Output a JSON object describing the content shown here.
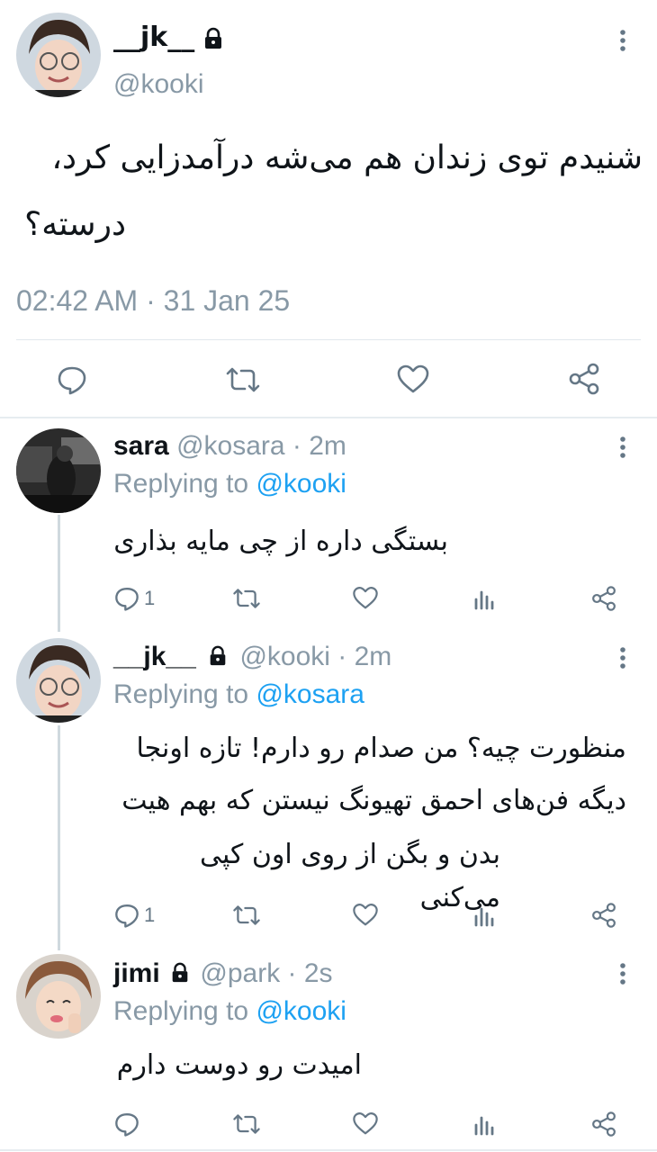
{
  "main_tweet": {
    "display_name": "__jk__",
    "handle": "@kooki",
    "text_line1": "شنیدم توی زندان هم می‌شه درآمدزایی کرد،",
    "text_line2": "درسته؟",
    "timestamp": "02:42 AM · 31 Jan 25"
  },
  "replies": [
    {
      "display_name": "sara",
      "handle_time": "@kosara · 2m",
      "replying_prefix": "Replying to",
      "replying_to": "@kooki",
      "text_lines": [
        "بستگی داره از چی مایه بذاری"
      ],
      "reply_count": "1"
    },
    {
      "display_name": "__jk__",
      "handle_time": "@kooki · 2m",
      "replying_prefix": "Replying to",
      "replying_to": "@kosara",
      "text_lines": [
        "منظورت چیه؟ من صدام رو دارم! تازه اونجا",
        "دیگه فن‌های احمق تهیونگ نیستن که بهم هیت",
        "بدن و بگن از روی اون کپی می‌کنی"
      ],
      "reply_count": "1"
    },
    {
      "display_name": "jimi",
      "handle_time": "@park · 2s",
      "replying_prefix": "Replying to",
      "replying_to": "@kooki",
      "text_lines": [
        "امیدت رو دوست دارم"
      ],
      "reply_count": ""
    }
  ],
  "colors": {
    "link": "#1da1f2",
    "muted": "#8899a6",
    "icon": "#657786",
    "divider": "#e1e8ed"
  },
  "icons": [
    "lock-icon",
    "more-icon",
    "reply-icon",
    "retweet-icon",
    "like-icon",
    "share-icon",
    "analytics-icon"
  ]
}
